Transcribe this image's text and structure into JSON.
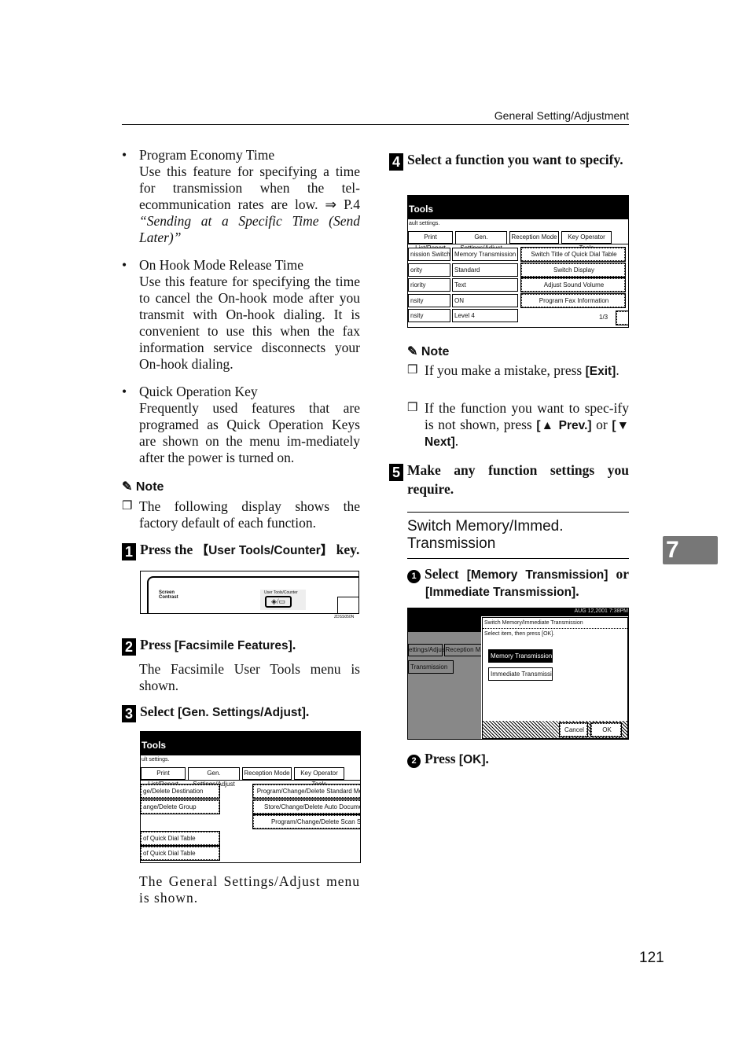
{
  "header": {
    "section": "General Setting/Adjustment",
    "page_number": "121",
    "chapter_tab": "7"
  },
  "left": {
    "bullets": [
      {
        "title": "Program Economy Time",
        "body": "Use this feature for specifying a time for transmission when the tel-ecommunication rates are low. ⇒ P.4 ",
        "ref": "“Sending at a Specific Time (Send Later)”"
      },
      {
        "title": "On Hook Mode Release Time",
        "body": "Use this feature for specifying the time to cancel the On-hook mode after you transmit with On-hook dialing. It is convenient to use this when the fax information service disconnects your On-hook dialing."
      },
      {
        "title": "Quick Operation Key",
        "body": "Frequently used features that are programed as Quick Operation Keys are shown on the menu im-mediately after the power is turned on."
      }
    ],
    "note_title": "Note",
    "note_item": "The following display shows the factory default of each function.",
    "step1": {
      "num": "1",
      "pre": "Press the ",
      "key": "【User Tools/Counter】",
      "post": " key."
    },
    "panel": {
      "screen_contrast": "Screen Contrast",
      "user_tools_label": "User Tools/Counter",
      "code": "ZDSS050N"
    },
    "step2": {
      "num": "2",
      "pre": "Press ",
      "key": "[Facsimile Features]",
      "post": ".",
      "desc": "The Facsimile User Tools menu is shown."
    },
    "step3": {
      "num": "3",
      "pre": "Select ",
      "key": "[Gen. Settings/Adjust]",
      "post": ".",
      "desc": "The General Settings/Adjust menu is shown."
    },
    "screen": {
      "title": "Tools",
      "sub": "ult settings.",
      "tabs": [
        "Print List/Report",
        "Gen. Settings/Adjust",
        "Reception Mode",
        "Key Operator Tools"
      ],
      "left_btns": [
        "ge/Delete Destination",
        "ange/Delete Group",
        "",
        "of Quick Dial Table",
        "of Quick Dial Table"
      ],
      "right_btns": [
        "Program/Change/Delete Standard Me",
        "Store/Change/Delete Auto Docume",
        "Program/Change/Delete Scan Si"
      ]
    }
  },
  "right": {
    "step4": {
      "num": "4",
      "text": "Select a function you want to specify."
    },
    "screen": {
      "title": "Tools",
      "sub": "ault settings.",
      "tabs": [
        "Print List/Report",
        "Gen. Settings/Adjust",
        "Reception Mode",
        "Key Operator Tools"
      ],
      "rows": [
        {
          "name": "nission Switch",
          "value": "Memory Transmission",
          "func": "Switch Title of Quick Dial Table"
        },
        {
          "name": "ority",
          "value": "Standard",
          "func": "Switch Display"
        },
        {
          "name": "riority",
          "value": "Text",
          "func": "Adjust Sound Volume"
        },
        {
          "name": "nsity",
          "value": "ON",
          "func": "Program Fax Information"
        },
        {
          "name": "nsity",
          "value": "Level 4",
          "func": ""
        }
      ],
      "page": "1/3"
    },
    "note_title": "Note",
    "note1": {
      "pre": "If you make a mistake, press ",
      "key": "[Exit]",
      "post": "."
    },
    "note2": {
      "pre": "If the function you want to spec-ify is not shown, press ",
      "key1": "[▲ Prev.]",
      "mid": " or ",
      "key2": "[▼ Next]",
      "post": "."
    },
    "step5": {
      "num": "5",
      "text": "Make any function settings you require."
    },
    "subheading": "Switch Memory/Immed. Transmission",
    "sub1": {
      "num": "1",
      "pre": "Select ",
      "key1": "[Memory Transmission]",
      "mid": " or ",
      "key2": "[Immediate Transmission]",
      "post": "."
    },
    "dialog": {
      "datetime": "AUG 12,2001 7:38PM",
      "title": "Switch Memory/Immediate Transmission",
      "instr": "Select item, then press [OK].",
      "options": [
        "Memory Transmission",
        "Immediate Transmission"
      ],
      "selected": "Memory Transmission",
      "cancel": "Cancel",
      "ok": "OK",
      "bg_tabs": [
        "ettings/Adjust",
        "Reception M"
      ],
      "bg_row": "Transmission"
    },
    "sub2": {
      "num": "2",
      "pre": "Press ",
      "key": "[OK]",
      "post": "."
    }
  }
}
